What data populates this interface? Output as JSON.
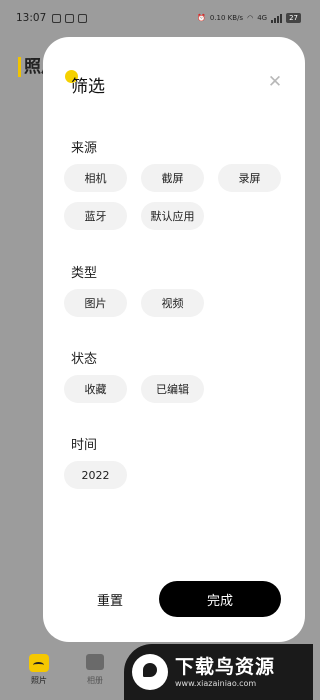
{
  "status_bar": {
    "time": "13:07",
    "speed": "0.10 KB/s",
    "network": "4G",
    "battery": "27"
  },
  "background_page": {
    "title": "照片",
    "accent": "#f2c400"
  },
  "bottom_nav": {
    "items": [
      {
        "label": "照片",
        "icon": "photos-icon",
        "active": true
      },
      {
        "label": "相册",
        "icon": "albums-icon",
        "active": false
      }
    ]
  },
  "filter_sheet": {
    "title": "筛选",
    "close_icon": "close-icon",
    "sections": [
      {
        "title": "来源",
        "chips": [
          "相机",
          "截屏",
          "录屏",
          "蓝牙",
          "默认应用"
        ]
      },
      {
        "title": "类型",
        "chips": [
          "图片",
          "视频"
        ]
      },
      {
        "title": "状态",
        "chips": [
          "收藏",
          "已编辑"
        ]
      },
      {
        "title": "时间",
        "chips": [
          "2022"
        ]
      }
    ],
    "reset_label": "重置",
    "done_label": "完成",
    "highlight_color": "#f5d100"
  },
  "watermark": {
    "text": "下载鸟资源",
    "url": "www.xiazainiao.com"
  }
}
